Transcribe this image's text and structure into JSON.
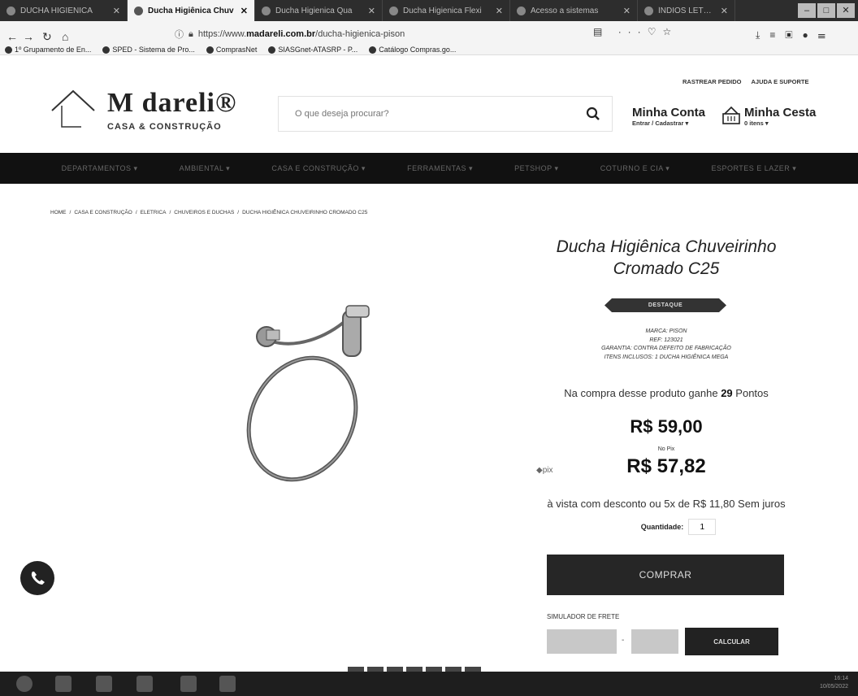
{
  "browser": {
    "tabs": [
      {
        "title": "DUCHA HIGIENICA",
        "active": false
      },
      {
        "title": "Ducha Higiênica Chuv",
        "active": true
      },
      {
        "title": "Ducha Higienica Qua",
        "active": false
      },
      {
        "title": "Ducha Higienica Flexi",
        "active": false
      },
      {
        "title": "Acesso a sistemas",
        "active": false
      },
      {
        "title": "ÍNDIOS LETRA - Pesq",
        "active": false
      }
    ],
    "url_prefix": "https://www.",
    "url_domain": "madareli.com.br",
    "url_path": "/ducha-higienica-pison",
    "bookmarks": [
      "1º Grupamento de En...",
      "SPED - Sistema de Pro...",
      "ComprasNet",
      "SIASGnet-ATASRP - P...",
      "Catálogo Compras.go..."
    ]
  },
  "header": {
    "logo_main": "M   dareli®",
    "logo_sub": "CASA & CONSTRUÇÃO",
    "search_placeholder": "O que deseja procurar?",
    "top_links": [
      "RASTREAR PEDIDO",
      "AJUDA E SUPORTE"
    ],
    "account_title": "Minha Conta",
    "account_sub": "Entrar / Cadastrar ▾",
    "cart_title": "Minha Cesta",
    "cart_sub": "0 itens ▾"
  },
  "nav": [
    "DEPARTAMENTOS ▾",
    "AMBIENTAL ▾",
    "CASA E CONSTRUÇÃO ▾",
    "FERRAMENTAS ▾",
    "PETSHOP ▾",
    "COTURNO E CIA ▾",
    "ESPORTES E LAZER ▾"
  ],
  "breadcrumb": [
    "HOME",
    "CASA E CONSTRUÇÃO",
    "ELETRICA",
    "CHUVEIROS E DUCHAS",
    "DUCHA HIGIÊNICA CHUVEIRINHO CROMADO C25"
  ],
  "product": {
    "title": "Ducha Higiênica Chuveirinho Cromado C25",
    "badge": "DESTAQUE",
    "specs": [
      "MARCA: PISON",
      "REF: 123021",
      "GARANTIA: CONTRA DEFEITO DE FABRICAÇÃO",
      "ITENS INCLUSOS: 1 DUCHA HIGIÊNICA MEGA"
    ],
    "points_prefix": "Na compra desse produto ganhe",
    "points_value": "29",
    "points_suffix": "Pontos",
    "price": "R$ 59,00",
    "pix_label": "No Pix",
    "pix_logo": "◆pix",
    "pix_price": "R$ 57,82",
    "installments": "à vista com desconto ou 5x de R$ 11,80 Sem juros",
    "qty_label": "Quantidade:",
    "qty_value": "1",
    "buy_label": "COMPRAR",
    "frete_label": "SIMULADOR DE FRETE",
    "calc_label": "CALCULAR"
  },
  "taskbar": {
    "time": "16:14",
    "date": "10/05/2022"
  }
}
